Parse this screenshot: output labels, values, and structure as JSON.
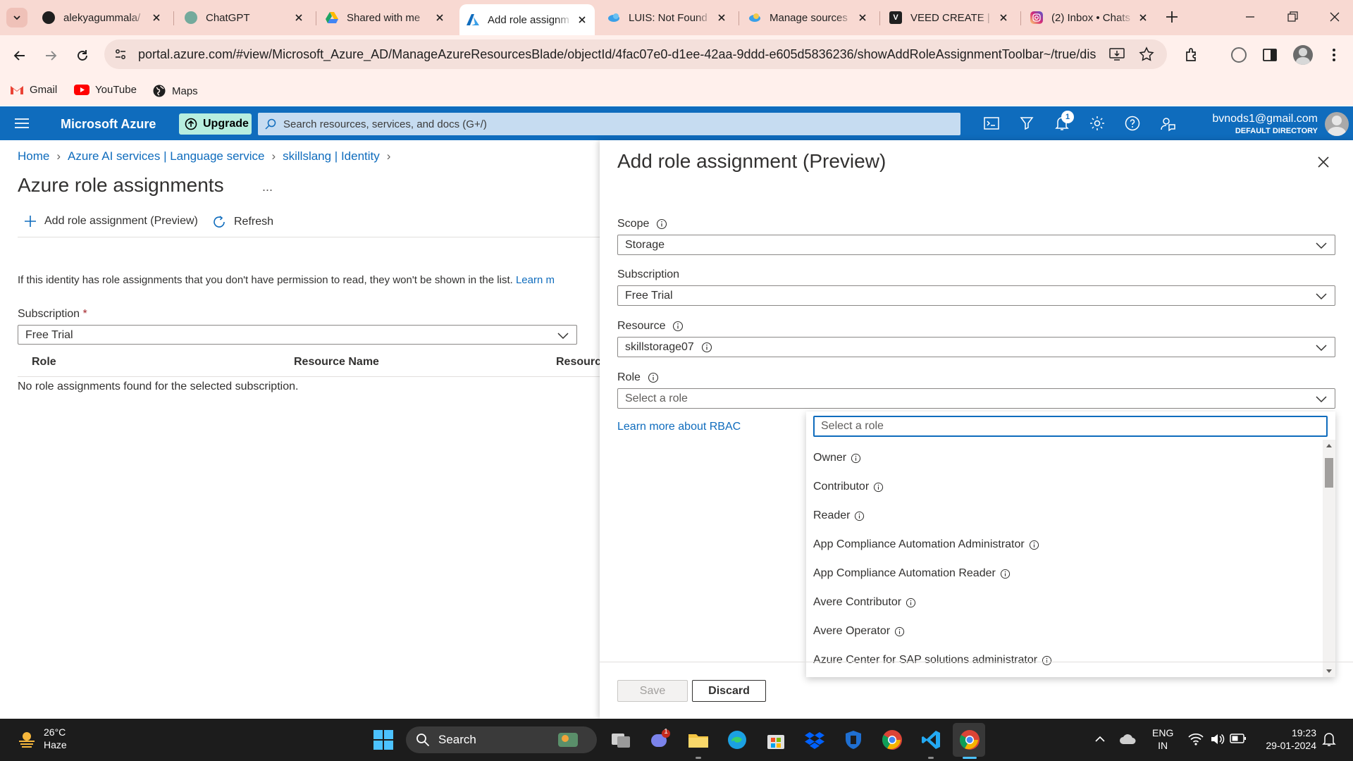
{
  "browser": {
    "tabs": [
      {
        "title": "alekyagummala/",
        "icon": "github-icon",
        "color": "#1f1f1f"
      },
      {
        "title": "ChatGPT",
        "icon": "chatgpt-icon",
        "color": "#74aa9c"
      },
      {
        "title": "Shared with me",
        "icon": "google-drive-icon",
        "color": "#1fa463"
      },
      {
        "title": "Add role assignm",
        "icon": "azure-icon",
        "color": "#0f6cbd",
        "active": true
      },
      {
        "title": "LUIS: Not Found",
        "icon": "luis-icon",
        "color": "#3aa0e8"
      },
      {
        "title": "Manage sources",
        "icon": "cloud-icon",
        "color": "#3aa0e8"
      },
      {
        "title": "VEED CREATE | E",
        "icon": "veed-icon",
        "color": "#1f1f1f"
      },
      {
        "title": "(2) Inbox • Chats",
        "icon": "instagram-icon",
        "color": "#d62976"
      }
    ],
    "url": "portal.azure.com/#view/Microsoft_Azure_AD/ManageAzureResourcesBlade/objectId/4fac07e0-d1ee-42aa-9ddd-e605d5836236/showAddRoleAssignmentToolbar~/true/display...",
    "bookmarks": [
      "Gmail",
      "YouTube",
      "Maps"
    ]
  },
  "azure": {
    "brand": "Microsoft Azure",
    "upgrade": "Upgrade",
    "search_placeholder": "Search resources, services, and docs (G+/)",
    "notifications": "1",
    "account_email": "bvnods1@gmail.com",
    "account_directory": "DEFAULT DIRECTORY",
    "accent": "#0f6cbd"
  },
  "leftpane": {
    "breadcrumbs": [
      "Home",
      "Azure AI services | Language service",
      "skillslang | Identity"
    ],
    "title": "Azure role assignments",
    "more": "...",
    "cmd_add": "Add role assignment (Preview)",
    "cmd_refresh": "Refresh",
    "info_text": "If this identity has role assignments that you don't have permission to read, they won't be shown in the list.",
    "info_link": "Learn m",
    "subscription_label": "Subscription",
    "required": "*",
    "subscription_value": "Free Trial",
    "columns": [
      "Role",
      "Resource Name",
      "Resource"
    ],
    "empty_text": "No role assignments found for the selected subscription."
  },
  "flyout": {
    "title": "Add role assignment (Preview)",
    "scope_label": "Scope",
    "scope_value": "Storage",
    "subscription_label": "Subscription",
    "subscription_value": "Free Trial",
    "resource_label": "Resource",
    "resource_value": "skillstorage07",
    "role_label": "Role",
    "role_placeholder": "Select a role",
    "rbac_link": "Learn more about RBAC",
    "dropdown_search_placeholder": "Select a role",
    "roles": [
      "Owner",
      "Contributor",
      "Reader",
      "App Compliance Automation Administrator",
      "App Compliance Automation Reader",
      "Avere Contributor",
      "Avere Operator",
      "Azure Center for SAP solutions administrator"
    ],
    "save": "Save",
    "discard": "Discard"
  },
  "taskbar": {
    "temperature": "26°C",
    "weather": "Haze",
    "search": "Search",
    "lang1": "ENG",
    "lang2": "IN",
    "time": "19:23",
    "date": "29-01-2024",
    "teams_badge": "1"
  }
}
